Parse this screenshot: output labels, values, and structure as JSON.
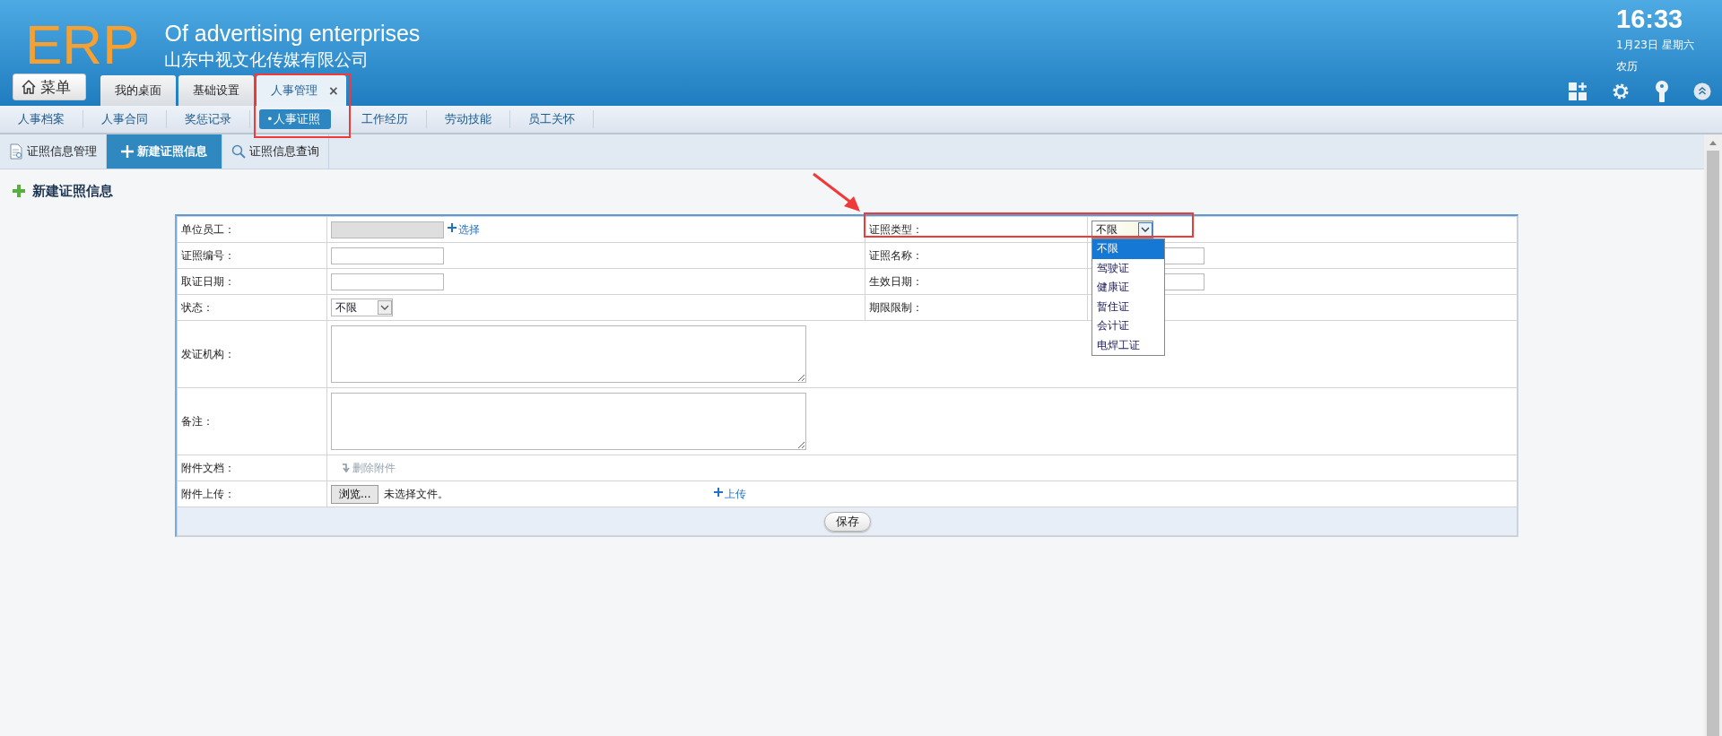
{
  "header": {
    "logo": "ERP",
    "tagline": "Of advertising enterprises",
    "company": "山东中视文化传媒有限公司",
    "time": "16:33",
    "date": "1月23日 星期六",
    "lunar": "农历"
  },
  "menu_button": "菜单",
  "tabs": [
    {
      "label": "我的桌面",
      "selected": false
    },
    {
      "label": "基础设置",
      "selected": false
    },
    {
      "label": "人事管理",
      "selected": true,
      "close": "×"
    }
  ],
  "subnav": [
    {
      "label": "人事档案",
      "selected": false
    },
    {
      "label": "人事合同",
      "selected": false
    },
    {
      "label": "奖惩记录",
      "selected": false
    },
    {
      "label": "•人事证照",
      "selected": true
    },
    {
      "label": "工作经历",
      "selected": false
    },
    {
      "label": "劳动技能",
      "selected": false
    },
    {
      "label": "员工关怀",
      "selected": false
    }
  ],
  "page_tabs": [
    {
      "label": "证照信息管理",
      "kind": "doc",
      "selected": false
    },
    {
      "label": "新建证照信息",
      "kind": "plus",
      "selected": true
    },
    {
      "label": "证照信息查询",
      "kind": "search",
      "selected": false
    }
  ],
  "section_title": "新建证照信息",
  "form": {
    "rows": [
      {
        "label": "单位员工：",
        "field": {
          "kind": "text",
          "disabled": true
        },
        "link": "选择",
        "right": {
          "label": "证照类型：",
          "field": {
            "kind": "select",
            "value": "不限",
            "open": true,
            "options": [
              {
                "label": "不限",
                "selected": true
              },
              {
                "label": "驾驶证",
                "selected": false
              },
              {
                "label": "健康证",
                "selected": false
              },
              {
                "label": "暂住证",
                "selected": false
              },
              {
                "label": "会计证",
                "selected": false
              },
              {
                "label": "电焊工证",
                "selected": false
              }
            ]
          }
        }
      },
      {
        "label": "证照编号：",
        "field": {
          "kind": "text",
          "disabled": false
        },
        "right": {
          "label": "证照名称：",
          "field": {
            "kind": "text",
            "disabled": false
          }
        }
      },
      {
        "label": "取证日期：",
        "field": {
          "kind": "text",
          "disabled": false
        },
        "right": {
          "label": "生效日期：",
          "field": {
            "kind": "text",
            "disabled": false
          }
        }
      },
      {
        "label": "状态：",
        "field": {
          "kind": "select",
          "value": "不限",
          "open": false
        },
        "right": {
          "label": "期限限制："
        }
      },
      {
        "label": "发证机构：",
        "field": {
          "kind": "textarea"
        }
      },
      {
        "label": "备注：",
        "field": {
          "kind": "textarea"
        }
      },
      {
        "label": "附件文档：",
        "field": {
          "kind": "action",
          "text": "删除附件",
          "disabled": true
        }
      },
      {
        "label": "附件上传：",
        "field": {
          "kind": "file",
          "button": "浏览...",
          "status": "未选择文件。",
          "link": "上传"
        }
      }
    ],
    "save": "保存"
  },
  "annotations": [
    {
      "kind": "box"
    },
    {
      "kind": "box"
    },
    {
      "kind": "arrow"
    }
  ]
}
